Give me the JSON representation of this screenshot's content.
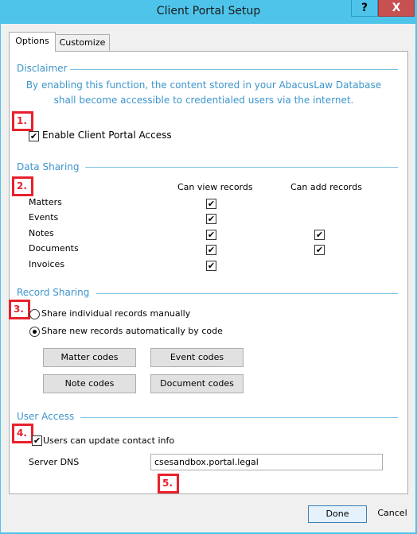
{
  "window": {
    "title": "Client Portal Setup",
    "help_label": "?",
    "close_label": "X"
  },
  "tabs": [
    {
      "label": "Options",
      "active": true
    },
    {
      "label": "Customize",
      "active": false
    }
  ],
  "disclaimer": {
    "title": "Disclaimer",
    "text_line1": "By enabling this function, the content stored in your AbacusLaw Database",
    "text_line2": "shall become accessible to credentialed users via the internet.",
    "enable_label": "Enable Client Portal Access",
    "enable_checked": true
  },
  "data_sharing": {
    "title": "Data Sharing",
    "col_view": "Can view records",
    "col_add": "Can add records",
    "rows": [
      {
        "label": "Matters",
        "view": true,
        "add": null
      },
      {
        "label": "Events",
        "view": true,
        "add": null
      },
      {
        "label": "Notes",
        "view": true,
        "add": true
      },
      {
        "label": "Documents",
        "view": true,
        "add": true
      },
      {
        "label": "Invoices",
        "view": true,
        "add": null
      }
    ]
  },
  "record_sharing": {
    "title": "Record Sharing",
    "option_manual": "Share individual records manually",
    "option_auto": "Share new records automatically by code",
    "selected": "auto",
    "buttons": {
      "matter_codes": "Matter codes",
      "event_codes": "Event codes",
      "note_codes": "Note codes",
      "document_codes": "Document codes"
    }
  },
  "user_access": {
    "title": "User Access",
    "update_contact_label": "Users can update contact info",
    "update_contact_checked": true,
    "server_dns_label": "Server DNS",
    "server_dns_value": "csesandbox.portal.legal"
  },
  "markers": [
    "1.",
    "2.",
    "3.",
    "4.",
    "5."
  ],
  "footer": {
    "done_label": "Done",
    "cancel_label": "Cancel"
  },
  "colors": {
    "accent": "#3d95cc",
    "marker": "#e8212d",
    "titlebar": "#4ec4ea",
    "close": "#c75050"
  }
}
